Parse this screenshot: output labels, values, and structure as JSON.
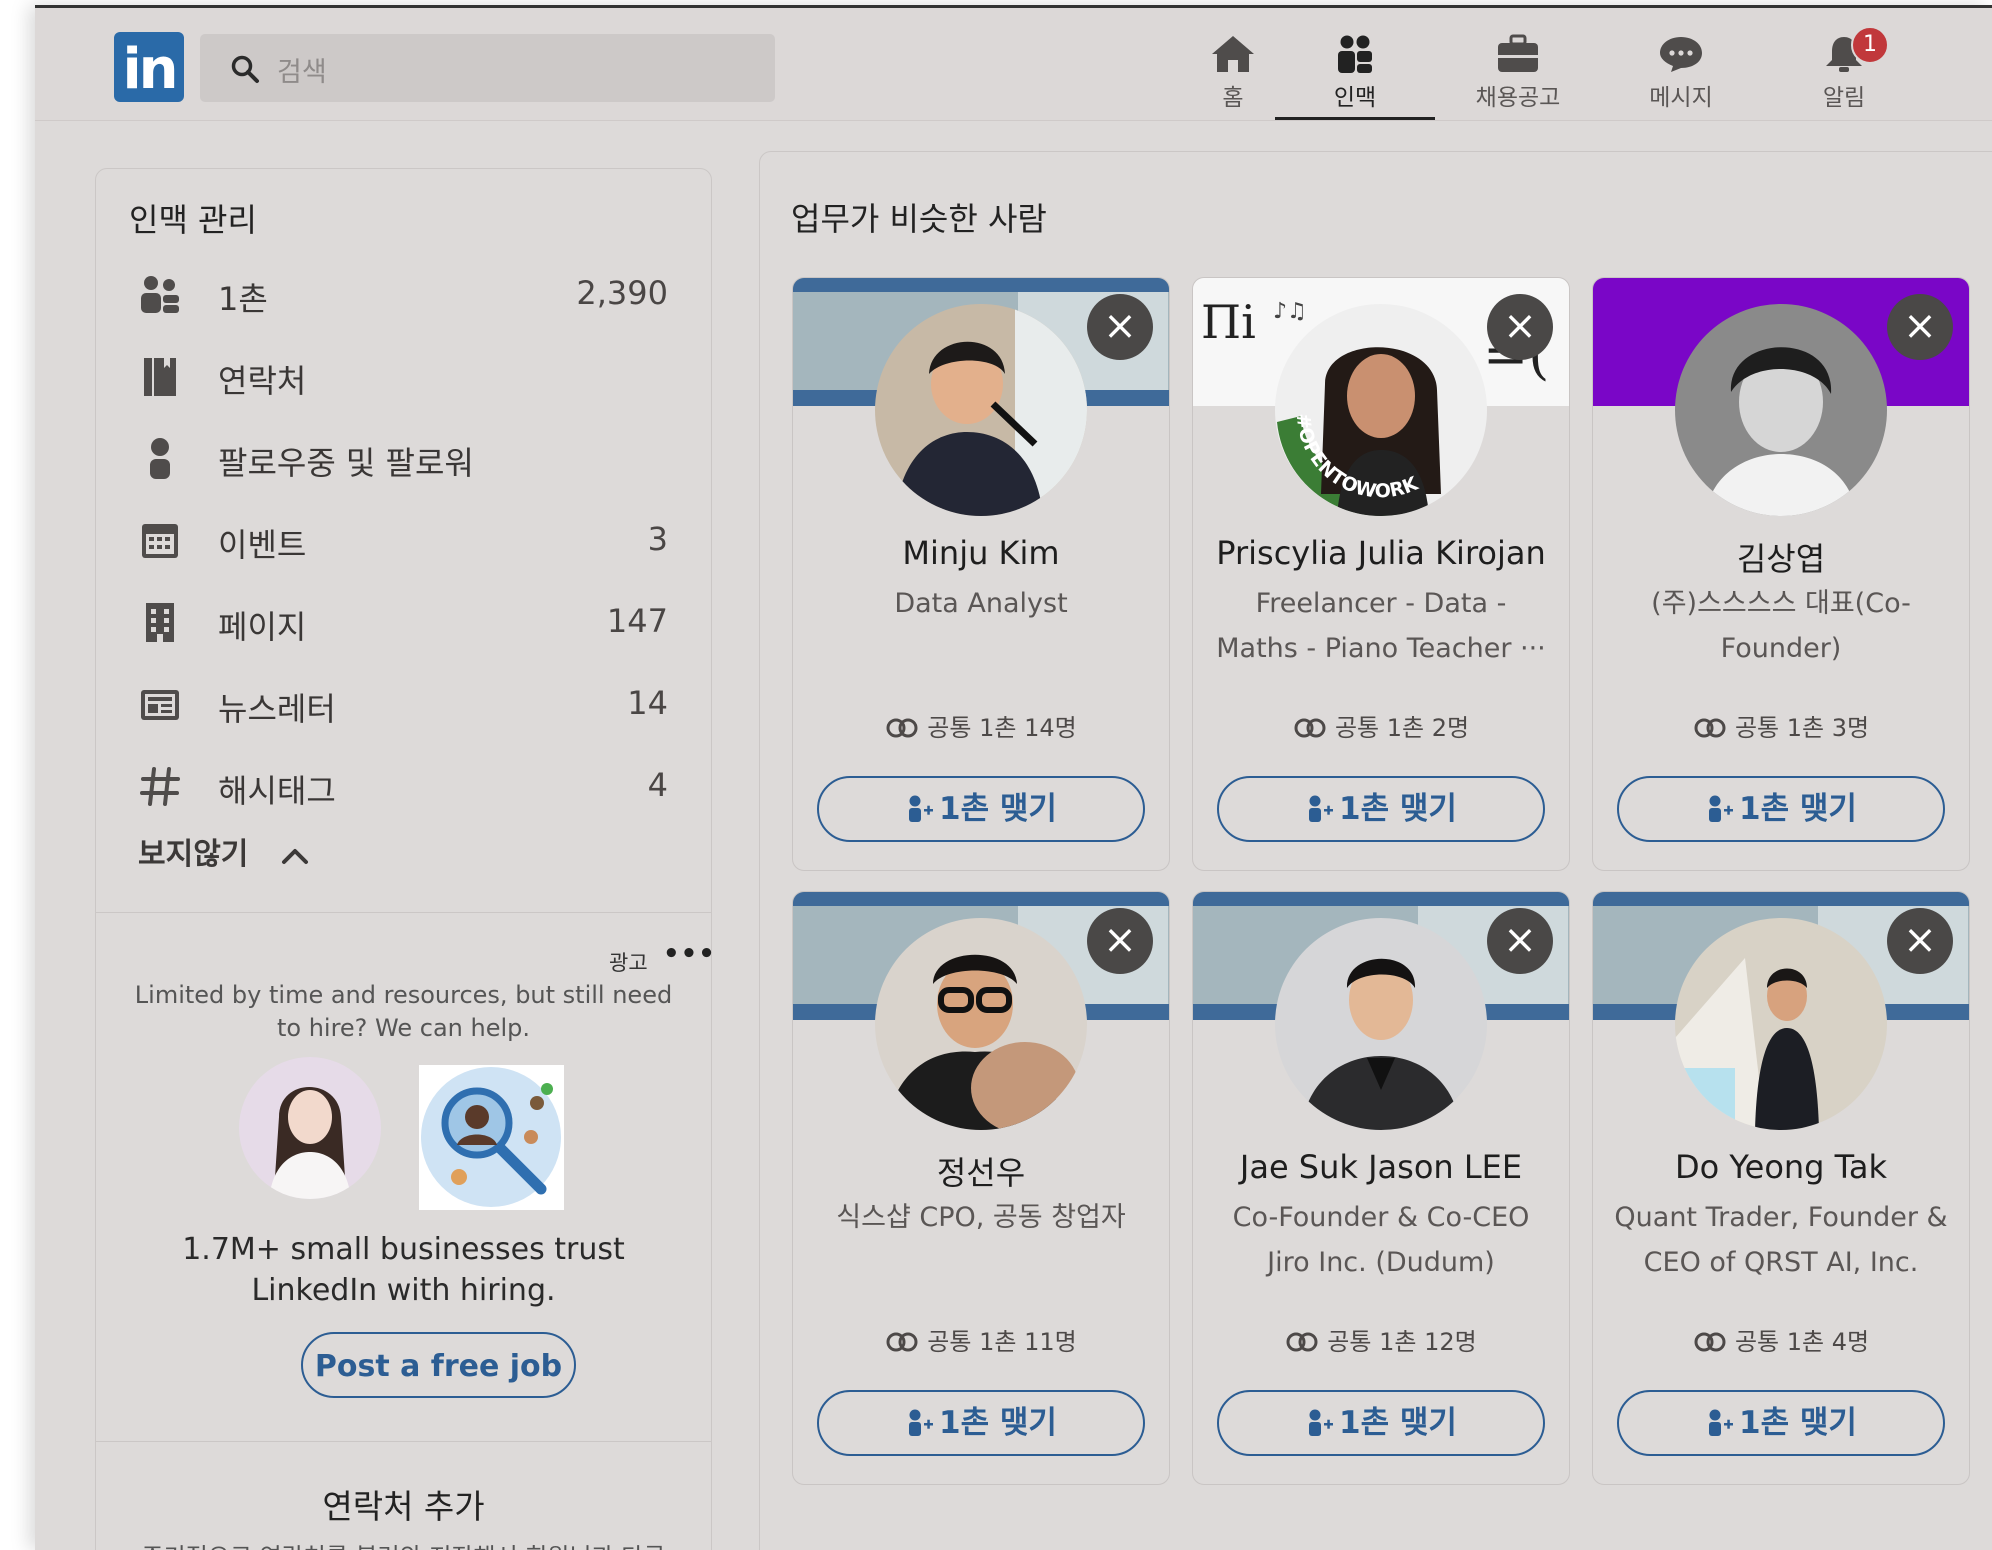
{
  "nav": {
    "search_placeholder": "검색",
    "items": [
      {
        "label": "홈",
        "icon": "home-icon"
      },
      {
        "label": "인맥",
        "icon": "network-icon",
        "active": true
      },
      {
        "label": "채용공고",
        "icon": "briefcase-icon"
      },
      {
        "label": "메시지",
        "icon": "message-icon"
      },
      {
        "label": "알림",
        "icon": "bell-icon",
        "badge": "1"
      }
    ]
  },
  "manage": {
    "title": "인맥 관리",
    "items": [
      {
        "label": "1촌",
        "count": "2,390",
        "icon": "connections-icon"
      },
      {
        "label": "연락처",
        "count": "",
        "icon": "contacts-book-icon"
      },
      {
        "label": "팔로우중 및 팔로워",
        "count": "",
        "icon": "person-icon"
      },
      {
        "label": "이벤트",
        "count": "3",
        "icon": "calendar-icon"
      },
      {
        "label": "페이지",
        "count": "147",
        "icon": "building-icon"
      },
      {
        "label": "뉴스레터",
        "count": "14",
        "icon": "newsletter-icon"
      },
      {
        "label": "해시태그",
        "count": "4",
        "icon": "hashtag-icon"
      }
    ],
    "collapse_label": "보지않기"
  },
  "ad": {
    "label": "광고",
    "more": "•••",
    "text": "Limited by time and resources, but still need to hire? We can help.",
    "headline": "1.7M+ small businesses trust LinkedIn with hiring.",
    "button": "Post a free job"
  },
  "contacts": {
    "title": "연락처 추가",
    "subtitle": "주기적으로 연락처를 불러와 저장해서 회원님과 다른"
  },
  "similar": {
    "title": "업무가 비슷한 사람",
    "connect_label": "1촌 맺기",
    "close_icon": "×",
    "cards": [
      {
        "name": "Minju Kim",
        "title": "Data Analyst",
        "mutual": "공통 1촌 14명"
      },
      {
        "name": "Priscylia Julia Kirojan",
        "title": "Freelancer - Data - Maths - Piano Teacher ···",
        "mutual": "공통 1촌 2명",
        "frame_text": "#OPENTOWORK"
      },
      {
        "name": "김상엽",
        "title": "(주)스스스스 대표(Co-Founder)",
        "mutual": "공통 1촌 3명"
      },
      {
        "name": "정선우",
        "title": "식스샵 CPO, 공동 창업자",
        "mutual": "공통 1촌 11명"
      },
      {
        "name": "Jae Suk Jason LEE",
        "title": "Co-Founder & Co-CEO Jiro Inc. (Dudum)",
        "mutual": "공통 1촌 12명"
      },
      {
        "name": "Do Yeong Tak",
        "title": "Quant Trader, Founder & CEO of QRST AI, Inc.",
        "mutual": "공통 1촌 4명"
      }
    ]
  },
  "colors": {
    "accent": "#2c5d93",
    "brand": "#2a6aa8",
    "badge": "#c1383b",
    "purple_banner": "#7a06c7"
  }
}
